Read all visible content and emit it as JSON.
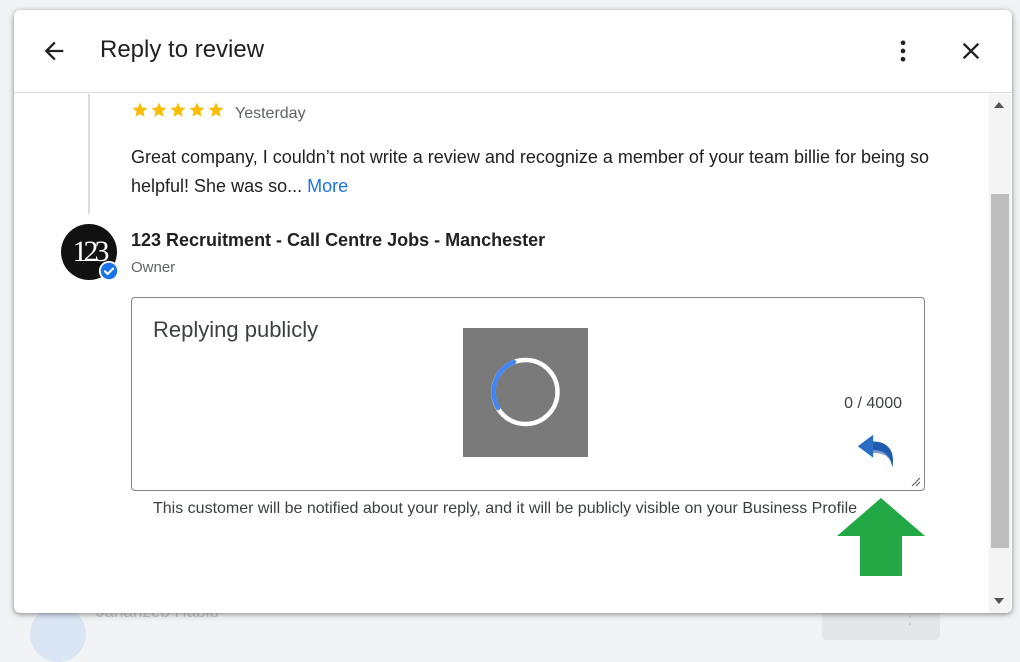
{
  "background": {
    "name": "Jahanzeb Habib"
  },
  "header": {
    "title": "Reply to review",
    "back_icon": "arrow-left-icon",
    "more_icon": "more-vert-icon",
    "close_icon": "close-icon"
  },
  "review": {
    "rating": 5,
    "date": "Yesterday",
    "text": "Great company, I couldn’t not write a review and recognize a member of your team billie for being so helpful! She was so...",
    "more_label": "More"
  },
  "owner": {
    "avatar_text": "123",
    "name": "123 Recruitment - Call Centre Jobs - Manchester",
    "role": "Owner"
  },
  "reply": {
    "placeholder": "Replying publicly",
    "char_count": "0 / 4000",
    "notice": "This customer will be notified about your reply, and it will be publicly visible on your Business Profile"
  },
  "colors": {
    "star": "#fbbc04",
    "link": "#1a73e8",
    "verified": "#1a73e8",
    "annotation_arrow": "#22a845",
    "spinner": "#4285f4"
  }
}
